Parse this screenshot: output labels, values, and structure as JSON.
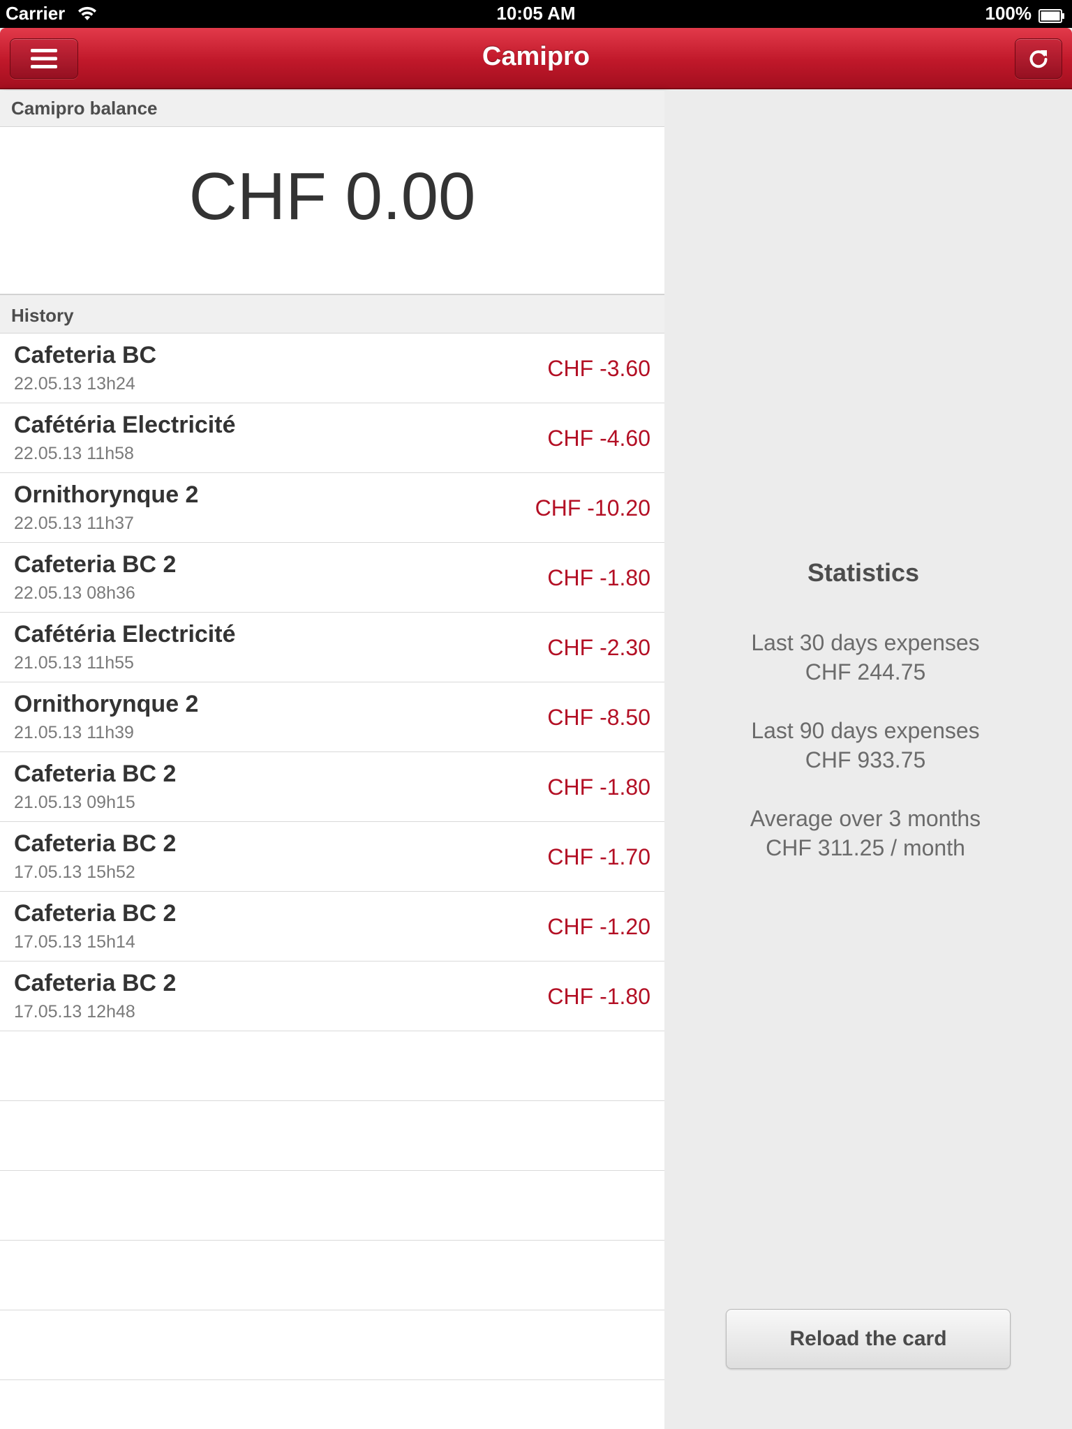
{
  "status_bar": {
    "carrier": "Carrier",
    "time": "10:05 AM",
    "battery": "100%"
  },
  "nav": {
    "title": "Camipro"
  },
  "balance": {
    "header": "Camipro balance",
    "value": "CHF 0.00"
  },
  "history": {
    "header": "History",
    "items": [
      {
        "place": "Cafeteria BC",
        "date": "22.05.13 13h24",
        "amount": "CHF -3.60"
      },
      {
        "place": "Cafétéria Electricité",
        "date": "22.05.13 11h58",
        "amount": "CHF -4.60"
      },
      {
        "place": "Ornithorynque 2",
        "date": "22.05.13 11h37",
        "amount": "CHF -10.20"
      },
      {
        "place": "Cafeteria BC 2",
        "date": "22.05.13 08h36",
        "amount": "CHF -1.80"
      },
      {
        "place": "Cafétéria Electricité",
        "date": "21.05.13 11h55",
        "amount": "CHF -2.30"
      },
      {
        "place": "Ornithorynque 2",
        "date": "21.05.13 11h39",
        "amount": "CHF -8.50"
      },
      {
        "place": "Cafeteria BC 2",
        "date": "21.05.13 09h15",
        "amount": "CHF -1.80"
      },
      {
        "place": "Cafeteria BC 2",
        "date": "17.05.13 15h52",
        "amount": "CHF -1.70"
      },
      {
        "place": "Cafeteria BC 2",
        "date": "17.05.13 15h14",
        "amount": "CHF -1.20"
      },
      {
        "place": "Cafeteria BC 2",
        "date": "17.05.13 12h48",
        "amount": "CHF -1.80"
      }
    ]
  },
  "statistics": {
    "title": "Statistics",
    "last30_label": "Last 30 days expenses",
    "last30_value": "CHF 244.75",
    "last90_label": "Last 90 days expenses",
    "last90_value": "CHF 933.75",
    "avg_label": "Average over 3 months",
    "avg_value": "CHF 311.25 / month"
  },
  "reload_button": "Reload the card",
  "colors": {
    "brand_red": "#c0182a",
    "amount_red": "#b30f24"
  },
  "icons": {
    "menu": "menu-icon",
    "refresh": "refresh-icon",
    "wifi": "wifi-icon",
    "battery": "battery-icon"
  }
}
